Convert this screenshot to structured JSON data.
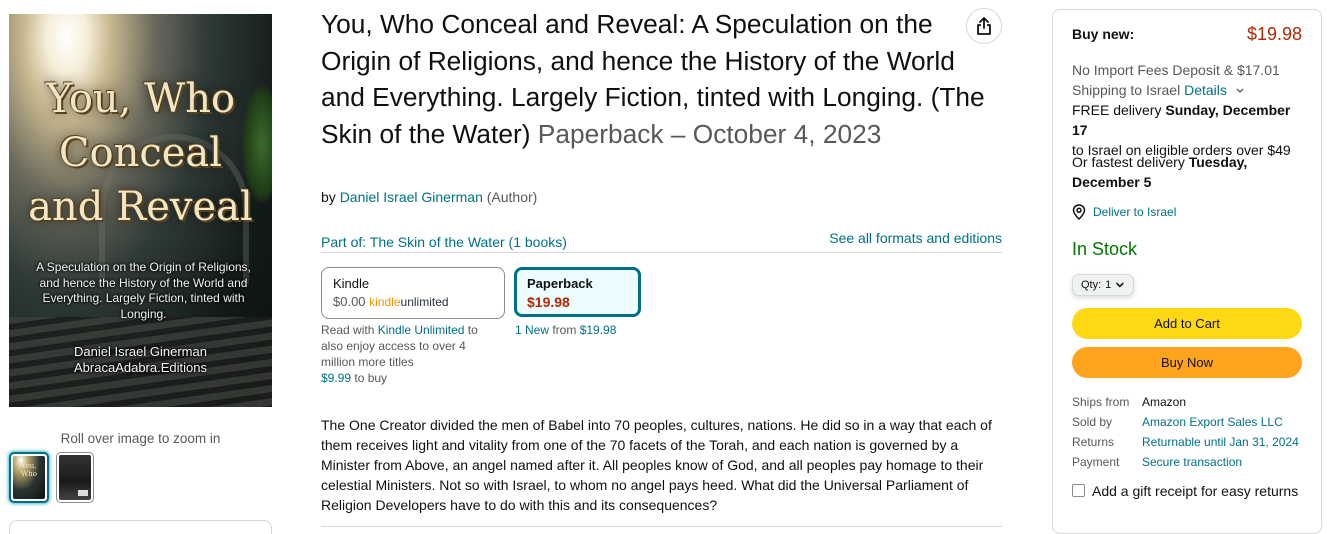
{
  "product": {
    "title": "You, Who Conceal and Reveal: A Speculation on the Origin of Religions, and hence the History of the World and Everything. Largely Fiction, tinted with Longing. (The Skin of the Water)",
    "format_date": "Paperback – October 4, 2023",
    "by_label": "by",
    "author_name": "Daniel Israel Ginerman",
    "author_role": "(Author)"
  },
  "cover": {
    "title_line1": "You, Who",
    "title_line2": "Conceal",
    "title_line3": "and Reveal",
    "subtitle": "A Speculation on the Origin of Religions, and hence the History of the World and Everything. Largely Fiction, tinted with Longing.",
    "author": "Daniel Israel Ginerman",
    "publisher": "AbracaAdabra.Editions"
  },
  "gallery": {
    "zoom_hint": "Roll over image to zoom in"
  },
  "series": {
    "part_of": "Part of: The Skin of the Water (1 books)",
    "see_all": "See all formats and editions"
  },
  "formats": {
    "kindle": {
      "name": "Kindle",
      "price": "$0.00",
      "ku_kindle": "kindle",
      "ku_unlimited": "unlimited",
      "note_prefix": "Read with ",
      "note_link": "Kindle Unlimited",
      "note_suffix": " to also enjoy access to over 4 million more titles",
      "buy_price": "$9.99",
      "buy_suffix": " to buy"
    },
    "paperback": {
      "name": "Paperback",
      "price": "$19.98",
      "new_label": "1 New",
      "from_label": " from ",
      "from_price": "$19.98"
    }
  },
  "description": "The One Creator divided the men of Babel into 70 peoples, cultures, nations. He did so in a way that each of them receives light and vitality from one of the 70 facets of the Torah, and each nation is governed by a Minister from Above, an angel named after it. All peoples know of God, and all peoples pay homage to their celestial Ministers. Not so with Israel, to whom no angel pays heed. What did the Universal Parliament of Religion Developers have to do with this and its consequences?",
  "buybox": {
    "buy_new_label": "Buy new:",
    "price": "$19.98",
    "import_fees": "No Import Fees Deposit & $17.01",
    "shipping_prefix": "Shipping to Israel ",
    "details_link": "Details",
    "free_delivery_prefix": "FREE delivery ",
    "free_delivery_date": "Sunday, December 17",
    "free_delivery_suffix": "to Israel on eligible orders over $49",
    "fastest_prefix": "Or fastest delivery ",
    "fastest_date": "Tuesday, December 5",
    "deliver_to": "Deliver to Israel",
    "stock_status": "In Stock",
    "qty_label": "Qty:",
    "qty_value": "1",
    "add_to_cart": "Add to Cart",
    "buy_now": "Buy Now",
    "ships_from_label": "Ships from",
    "ships_from_value": "Amazon",
    "sold_by_label": "Sold by",
    "sold_by_value": "Amazon Export Sales LLC",
    "returns_label": "Returns",
    "returns_value": "Returnable until Jan 31, 2024",
    "payment_label": "Payment",
    "payment_value": "Secure transaction",
    "gift_receipt": "Add a gift receipt for easy returns"
  },
  "icons": {
    "share": "share-icon",
    "location": "location-pin-icon",
    "chevron": "chevron-down-icon"
  },
  "colors": {
    "link": "#007185",
    "price_red": "#B12704",
    "in_stock": "#007600",
    "add_to_cart": "#FFD814",
    "buy_now": "#FFA41C",
    "selected_format": "#007185"
  }
}
